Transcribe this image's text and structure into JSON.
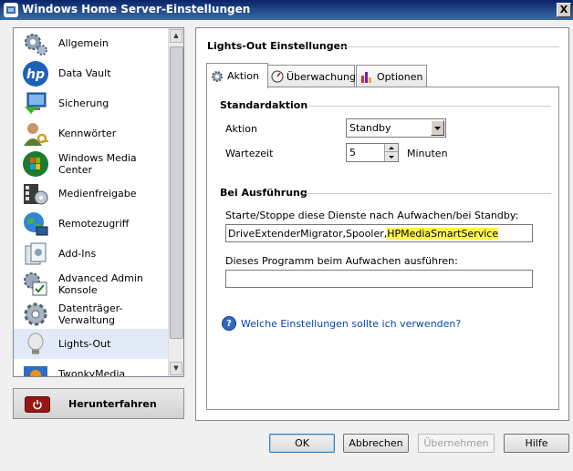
{
  "window": {
    "title": "Windows Home Server-Einstellungen",
    "close_label": "X"
  },
  "sidebar": {
    "items": [
      {
        "label": "Allgemein",
        "icon": "gears-icon"
      },
      {
        "label": "Data Vault",
        "icon": "hp-logo-icon"
      },
      {
        "label": "Sicherung",
        "icon": "backup-monitor-icon"
      },
      {
        "label": "Kennwörter",
        "icon": "user-key-icon"
      },
      {
        "label": "Windows Media Center",
        "icon": "media-center-icon"
      },
      {
        "label": "Medienfreigabe",
        "icon": "media-share-icon"
      },
      {
        "label": "Remotezugriff",
        "icon": "globe-computer-icon"
      },
      {
        "label": "Add-Ins",
        "icon": "add-ins-icon"
      },
      {
        "label": "Advanced Admin Konsole",
        "icon": "admin-console-icon"
      },
      {
        "label": "Datenträger-Verwaltung",
        "icon": "disk-gear-icon"
      },
      {
        "label": "Lights-Out",
        "icon": "lightbulb-icon"
      },
      {
        "label": "TwonkyMedia",
        "icon": "twonky-icon"
      }
    ],
    "selected_index": 10,
    "shutdown_label": "Herunterfahren"
  },
  "main": {
    "title": "Lights-Out Einstellungen",
    "tabs": [
      {
        "label": "Aktion",
        "icon": "gear-icon"
      },
      {
        "label": "Überwachung",
        "icon": "gauge-icon"
      },
      {
        "label": "Optionen",
        "icon": "bar-chart-icon"
      }
    ],
    "active_tab": 0,
    "standard": {
      "title": "Standardaktion",
      "action_label": "Aktion",
      "action_value": "Standby",
      "wait_label": "Wartezeit",
      "wait_value": "5",
      "wait_unit": "Minuten"
    },
    "execution": {
      "title": "Bei Ausführung",
      "services_label": "Starte/Stoppe diese Dienste nach Aufwachen/bei Standby:",
      "services_prefix": "DriveExtenderMigrator,Spooler,",
      "services_highlight": "HPMediaSmartService",
      "program_label": "Dieses Programm beim Aufwachen ausführen:",
      "program_value": ""
    },
    "help_link": "Welche Einstellungen sollte ich verwenden?"
  },
  "buttons": {
    "ok": "OK",
    "cancel": "Abbrechen",
    "apply": "Übernehmen",
    "help": "Hilfe"
  }
}
